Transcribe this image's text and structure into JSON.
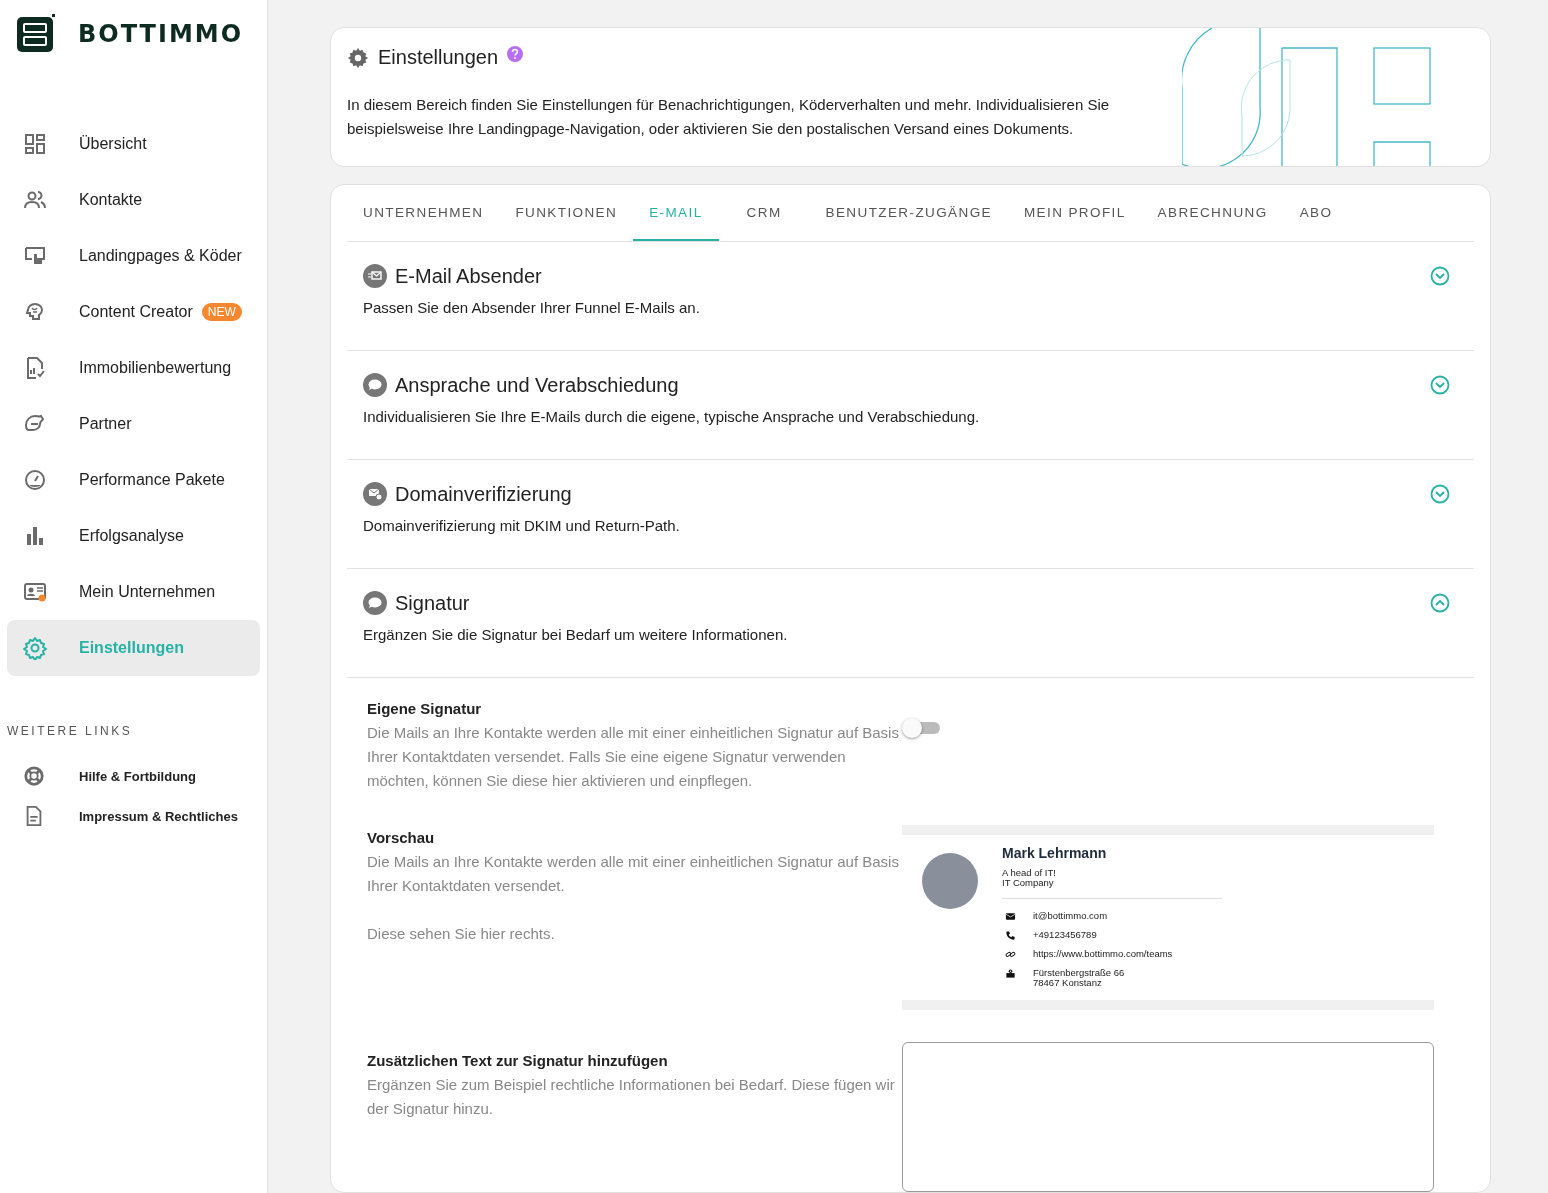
{
  "brand": {
    "name": "BOTTIMMO"
  },
  "sidebar": {
    "items": [
      {
        "label": "Übersicht",
        "selected": false
      },
      {
        "label": "Kontakte",
        "selected": false
      },
      {
        "label": "Landingpages & Köder",
        "selected": false
      },
      {
        "label": "Content Creator",
        "selected": false,
        "badge": "NEW"
      },
      {
        "label": "Immobilienbewertung",
        "selected": false
      },
      {
        "label": "Partner",
        "selected": false
      },
      {
        "label": "Performance Pakete",
        "selected": false
      },
      {
        "label": "Erfolgsanalyse",
        "selected": false
      },
      {
        "label": "Mein Unternehmen",
        "selected": false
      },
      {
        "label": "Einstellungen",
        "selected": true
      }
    ],
    "links_heading": "WEITERE LINKS",
    "links": [
      "Hilfe & Fortbildung",
      "Impressum & Rechtliches"
    ]
  },
  "header": {
    "title": "Einstellungen",
    "description": "In diesem Bereich finden Sie Einstellungen für Benachrichtigungen, Köderverhalten und mehr. Individualisieren Sie beispielsweise Ihre Landingpage-Navigation, oder aktivieren Sie den postalischen Versand eines Dokuments."
  },
  "tabs": [
    {
      "label": "UNTERNEHMEN",
      "selected": false
    },
    {
      "label": "FUNKTIONEN",
      "selected": false
    },
    {
      "label": "E-MAIL",
      "selected": true
    },
    {
      "label": "CRM",
      "selected": false
    },
    {
      "label": "BENUTZER-ZUGÄNGE",
      "selected": false
    },
    {
      "label": "MEIN PROFIL",
      "selected": false
    },
    {
      "label": "ABRECHNUNG",
      "selected": false
    },
    {
      "label": "ABO",
      "selected": false
    }
  ],
  "sections": [
    {
      "title": "E-Mail Absender",
      "description": "Passen Sie den Absender Ihrer Funnel E-Mails an.",
      "expanded": false
    },
    {
      "title": "Ansprache und Verabschiedung",
      "description": "Individualisieren Sie Ihre E-Mails durch die eigene, typische Ansprache und Verabschiedung.",
      "expanded": false
    },
    {
      "title": "Domainverifizierung",
      "description": "Domainverifizierung mit DKIM und Return-Path.",
      "expanded": false
    },
    {
      "title": "Signatur",
      "description": "Ergänzen Sie die Signatur bei Bedarf um weitere Informationen.",
      "expanded": true
    }
  ],
  "signature": {
    "own": {
      "title": "Eigene Signatur",
      "description": "Die Mails an Ihre Kontakte werden alle mit einer einheitlichen Signatur auf Basis Ihrer Kontaktdaten versendet. Falls Sie eine eigene Signatur verwenden möchten, können Sie diese hier aktivieren und einpflegen.",
      "on": false
    },
    "preview": {
      "title": "Vorschau",
      "description": "Die Mails an Ihre Kontakte werden alle mit einer einheitlichen Signatur auf Basis Ihrer Kontaktdaten versendet.",
      "note": "Diese sehen Sie hier rechts.",
      "name": "Mark Lehrmann",
      "role": "A head of IT!",
      "company": "IT Company",
      "contacts": [
        {
          "kind": "email",
          "text": "it@bottimmo.com"
        },
        {
          "kind": "phone",
          "text": "+49123456789"
        },
        {
          "kind": "link",
          "text": "https://www.bottimmo.com/teams"
        },
        {
          "kind": "address",
          "text": "Fürstenbergstraße 66",
          "text2": "78467 Konstanz"
        }
      ]
    },
    "extra": {
      "title": "Zusätzlichen Text zur Signatur hinzufügen",
      "description": "Ergänzen Sie zum Beispiel rechtliche Informationen bei Bedarf. Diese fügen wir der Signatur hinzu."
    }
  }
}
